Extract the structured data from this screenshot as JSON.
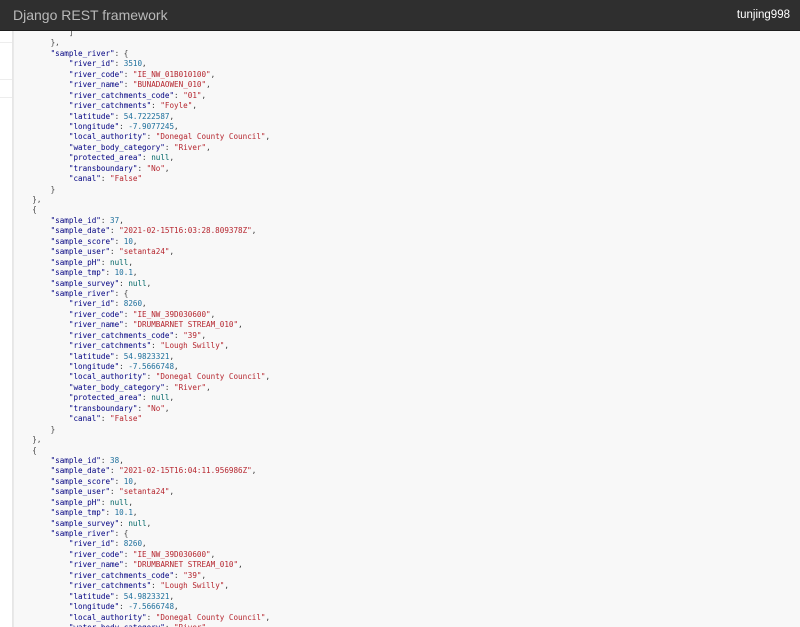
{
  "navbar": {
    "brand": "Django REST framework",
    "user": "tunjing998"
  },
  "colors": {
    "navbar_bg": "#2f2f2f",
    "brand_text": "#b9b9b9",
    "user_text": "#ffffff",
    "code_bg": "#f8f8f8",
    "key_color": "#000080",
    "string_color": "#b5252e",
    "number_color": "#1d6f9c"
  },
  "json_lines": [
    {
      "indent": 3,
      "open": "]"
    },
    {
      "indent": 2,
      "open": "},"
    },
    {
      "indent": 2,
      "key": "\"sample_river\"",
      "open": "{"
    },
    {
      "indent": 3,
      "key": "\"river_id\"",
      "value": "3510",
      "type": "num"
    },
    {
      "indent": 3,
      "key": "\"river_code\"",
      "value": "\"IE_NW_01B010100\"",
      "type": "str"
    },
    {
      "indent": 3,
      "key": "\"river_name\"",
      "value": "\"BUNADAOWEN_010\"",
      "type": "str"
    },
    {
      "indent": 3,
      "key": "\"river_catchments_code\"",
      "value": "\"01\"",
      "type": "str"
    },
    {
      "indent": 3,
      "key": "\"river_catchments\"",
      "value": "\"Foyle\"",
      "type": "str"
    },
    {
      "indent": 3,
      "key": "\"latitude\"",
      "value": "54.7222587",
      "type": "num"
    },
    {
      "indent": 3,
      "key": "\"longitude\"",
      "value": "-7.9077245",
      "type": "num"
    },
    {
      "indent": 3,
      "key": "\"local_authority\"",
      "value": "\"Donegal County Council\"",
      "type": "str"
    },
    {
      "indent": 3,
      "key": "\"water_body_category\"",
      "value": "\"River\"",
      "type": "str"
    },
    {
      "indent": 3,
      "key": "\"protected_area\"",
      "value": "null",
      "type": "const"
    },
    {
      "indent": 3,
      "key": "\"transboundary\"",
      "value": "\"No\"",
      "type": "str"
    },
    {
      "indent": 3,
      "key": "\"canal\"",
      "value": "\"False\"",
      "type": "str",
      "last": true
    },
    {
      "indent": 2,
      "open": "}"
    },
    {
      "indent": 1,
      "open": "},"
    },
    {
      "indent": 1,
      "open": "{"
    },
    {
      "indent": 2,
      "key": "\"sample_id\"",
      "value": "37",
      "type": "num"
    },
    {
      "indent": 2,
      "key": "\"sample_date\"",
      "value": "\"2021-02-15T16:03:28.809378Z\"",
      "type": "str"
    },
    {
      "indent": 2,
      "key": "\"sample_score\"",
      "value": "10",
      "type": "num"
    },
    {
      "indent": 2,
      "key": "\"sample_user\"",
      "value": "\"setanta24\"",
      "type": "str"
    },
    {
      "indent": 2,
      "key": "\"sample_pH\"",
      "value": "null",
      "type": "const"
    },
    {
      "indent": 2,
      "key": "\"sample_tmp\"",
      "value": "10.1",
      "type": "num"
    },
    {
      "indent": 2,
      "key": "\"sample_survey\"",
      "value": "null",
      "type": "const"
    },
    {
      "indent": 2,
      "key": "\"sample_river\"",
      "open": "{"
    },
    {
      "indent": 3,
      "key": "\"river_id\"",
      "value": "8260",
      "type": "num"
    },
    {
      "indent": 3,
      "key": "\"river_code\"",
      "value": "\"IE_NW_39D030600\"",
      "type": "str"
    },
    {
      "indent": 3,
      "key": "\"river_name\"",
      "value": "\"DRUMBARNET STREAM_010\"",
      "type": "str"
    },
    {
      "indent": 3,
      "key": "\"river_catchments_code\"",
      "value": "\"39\"",
      "type": "str"
    },
    {
      "indent": 3,
      "key": "\"river_catchments\"",
      "value": "\"Lough Swilly\"",
      "type": "str"
    },
    {
      "indent": 3,
      "key": "\"latitude\"",
      "value": "54.9823321",
      "type": "num"
    },
    {
      "indent": 3,
      "key": "\"longitude\"",
      "value": "-7.5666748",
      "type": "num"
    },
    {
      "indent": 3,
      "key": "\"local_authority\"",
      "value": "\"Donegal County Council\"",
      "type": "str"
    },
    {
      "indent": 3,
      "key": "\"water_body_category\"",
      "value": "\"River\"",
      "type": "str"
    },
    {
      "indent": 3,
      "key": "\"protected_area\"",
      "value": "null",
      "type": "const"
    },
    {
      "indent": 3,
      "key": "\"transboundary\"",
      "value": "\"No\"",
      "type": "str"
    },
    {
      "indent": 3,
      "key": "\"canal\"",
      "value": "\"False\"",
      "type": "str",
      "last": true
    },
    {
      "indent": 2,
      "open": "}"
    },
    {
      "indent": 1,
      "open": "},"
    },
    {
      "indent": 1,
      "open": "{"
    },
    {
      "indent": 2,
      "key": "\"sample_id\"",
      "value": "38",
      "type": "num"
    },
    {
      "indent": 2,
      "key": "\"sample_date\"",
      "value": "\"2021-02-15T16:04:11.956986Z\"",
      "type": "str"
    },
    {
      "indent": 2,
      "key": "\"sample_score\"",
      "value": "10",
      "type": "num"
    },
    {
      "indent": 2,
      "key": "\"sample_user\"",
      "value": "\"setanta24\"",
      "type": "str"
    },
    {
      "indent": 2,
      "key": "\"sample_pH\"",
      "value": "null",
      "type": "const"
    },
    {
      "indent": 2,
      "key": "\"sample_tmp\"",
      "value": "10.1",
      "type": "num"
    },
    {
      "indent": 2,
      "key": "\"sample_survey\"",
      "value": "null",
      "type": "const"
    },
    {
      "indent": 2,
      "key": "\"sample_river\"",
      "open": "{"
    },
    {
      "indent": 3,
      "key": "\"river_id\"",
      "value": "8260",
      "type": "num"
    },
    {
      "indent": 3,
      "key": "\"river_code\"",
      "value": "\"IE_NW_39D030600\"",
      "type": "str"
    },
    {
      "indent": 3,
      "key": "\"river_name\"",
      "value": "\"DRUMBARNET STREAM_010\"",
      "type": "str"
    },
    {
      "indent": 3,
      "key": "\"river_catchments_code\"",
      "value": "\"39\"",
      "type": "str"
    },
    {
      "indent": 3,
      "key": "\"river_catchments\"",
      "value": "\"Lough Swilly\"",
      "type": "str"
    },
    {
      "indent": 3,
      "key": "\"latitude\"",
      "value": "54.9823321",
      "type": "num"
    },
    {
      "indent": 3,
      "key": "\"longitude\"",
      "value": "-7.5666748",
      "type": "num"
    },
    {
      "indent": 3,
      "key": "\"local_authority\"",
      "value": "\"Donegal County Council\"",
      "type": "str"
    },
    {
      "indent": 3,
      "key": "\"water_body_category\"",
      "value": "\"River\"",
      "type": "str"
    }
  ]
}
